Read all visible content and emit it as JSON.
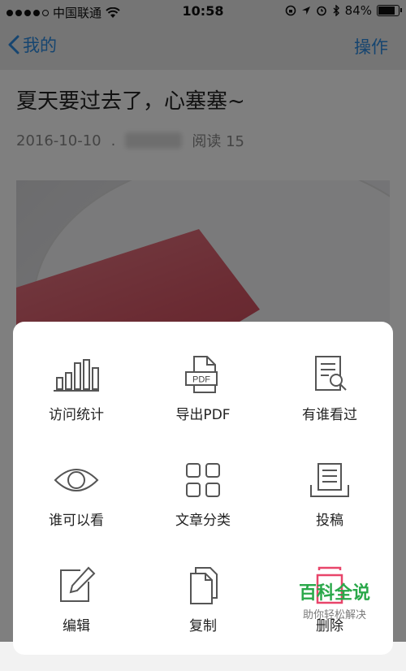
{
  "status_bar": {
    "carrier": "中国联通",
    "time": "10:58",
    "battery": "84%",
    "battery_level": 0.84
  },
  "nav": {
    "back_label": "我的",
    "action_label": "操作"
  },
  "article": {
    "title": "夏天要过去了，心塞塞~",
    "date": "2016-10-10",
    "dot": ".",
    "reads": "阅读 15"
  },
  "action_sheet": {
    "items": [
      {
        "label": "访问统计",
        "icon": "bar-chart-icon"
      },
      {
        "label": "导出PDF",
        "icon": "pdf-file-icon"
      },
      {
        "label": "有谁看过",
        "icon": "document-search-icon"
      },
      {
        "label": "谁可以看",
        "icon": "eye-icon"
      },
      {
        "label": "文章分类",
        "icon": "grid-icon"
      },
      {
        "label": "投稿",
        "icon": "submit-tray-icon"
      },
      {
        "label": "编辑",
        "icon": "edit-icon"
      },
      {
        "label": "复制",
        "icon": "copy-icon"
      },
      {
        "label": "删除",
        "icon": "delete-icon"
      }
    ]
  },
  "watermark": {
    "title": "百科全说",
    "subtitle": "助你轻松解决"
  },
  "colors": {
    "accent": "#2d8be0",
    "delete": "#e8456a",
    "watermark": "#2aa84a"
  }
}
